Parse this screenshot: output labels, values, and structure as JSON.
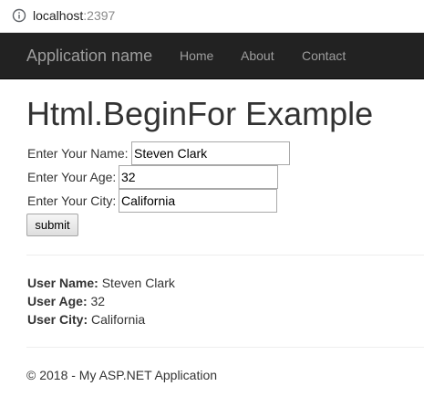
{
  "browser": {
    "url_host": "localhost",
    "url_port": ":2397",
    "info_icon": "info-circle-icon"
  },
  "navbar": {
    "brand": "Application name",
    "links": [
      "Home",
      "About",
      "Contact"
    ],
    "background": "#222222",
    "link_color": "#9d9d9d"
  },
  "page": {
    "title": "Html.BeginFor Example"
  },
  "form": {
    "name_label": "Enter Your Name:",
    "name_value": "Steven Clark",
    "age_label": "Enter Your Age:",
    "age_value": "32",
    "city_label": "Enter Your City:",
    "city_value": "California",
    "submit_label": "submit"
  },
  "result": {
    "name_label": "User Name:",
    "name_value": "Steven Clark",
    "age_label": "User Age:",
    "age_value": "32",
    "city_label": "User City:",
    "city_value": "California"
  },
  "footer": {
    "text": "© 2018 - My ASP.NET Application"
  }
}
